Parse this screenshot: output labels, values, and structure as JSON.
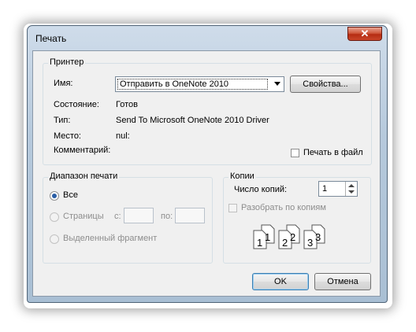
{
  "window": {
    "title": "Печать",
    "close_label": "✕"
  },
  "printer": {
    "legend": "Принтер",
    "name_label": "Имя:",
    "name_value": "Отправить в OneNote 2010",
    "properties_button": "Свойства...",
    "status_label": "Состояние:",
    "status_value": "Готов",
    "type_label": "Тип:",
    "type_value": "Send To Microsoft OneNote 2010 Driver",
    "where_label": "Место:",
    "where_value": "nul:",
    "comment_label": "Комментарий:",
    "print_to_file_label": "Печать в файл"
  },
  "range": {
    "legend": "Диапазон печати",
    "all_label": "Все",
    "pages_label": "Страницы",
    "from_label": "с:",
    "to_label": "по:",
    "selection_label": "Выделенный фрагмент"
  },
  "copies": {
    "legend": "Копии",
    "count_label": "Число копий:",
    "count_value": "1",
    "collate_label": "Разобрать по копиям",
    "collate_icon_digits": [
      "1",
      "1",
      "2",
      "2",
      "3",
      "3"
    ]
  },
  "buttons": {
    "ok": "OK",
    "cancel": "Отмена"
  }
}
